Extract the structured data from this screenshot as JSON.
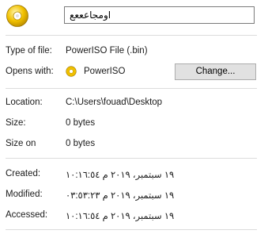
{
  "file": {
    "icon": "poweriso-disc-icon",
    "name": "اومجاعععع"
  },
  "type_of_file": {
    "label": "Type of file:",
    "value": "PowerISO File (.bin)"
  },
  "opens_with": {
    "label": "Opens with:",
    "app": "PowerISO",
    "app_icon": "poweriso-disc-icon",
    "button": "Change..."
  },
  "location": {
    "label": "Location:",
    "value": "C:\\Users\\fouad\\Desktop"
  },
  "size": {
    "label": "Size:",
    "value": "0 bytes"
  },
  "size_on": {
    "label": "Size on",
    "value": "0 bytes"
  },
  "created": {
    "label": "Created:",
    "value": "١٩ سبتمبر، ٢٠١٩ م ١٠:١٦:٥٤"
  },
  "modified": {
    "label": "Modified:",
    "value": "١٩ سبتمبر، ٢٠١٩ م ٠٣:٥٣:٢٣"
  },
  "accessed": {
    "label": "Accessed:",
    "value": "١٩ سبتمبر، ٢٠١٩ م ١٠:١٦:٥٤"
  },
  "colors": {
    "disc_gold": "#e8b400",
    "button_bg": "#e1e1e1",
    "separator": "#dcdcdc"
  }
}
